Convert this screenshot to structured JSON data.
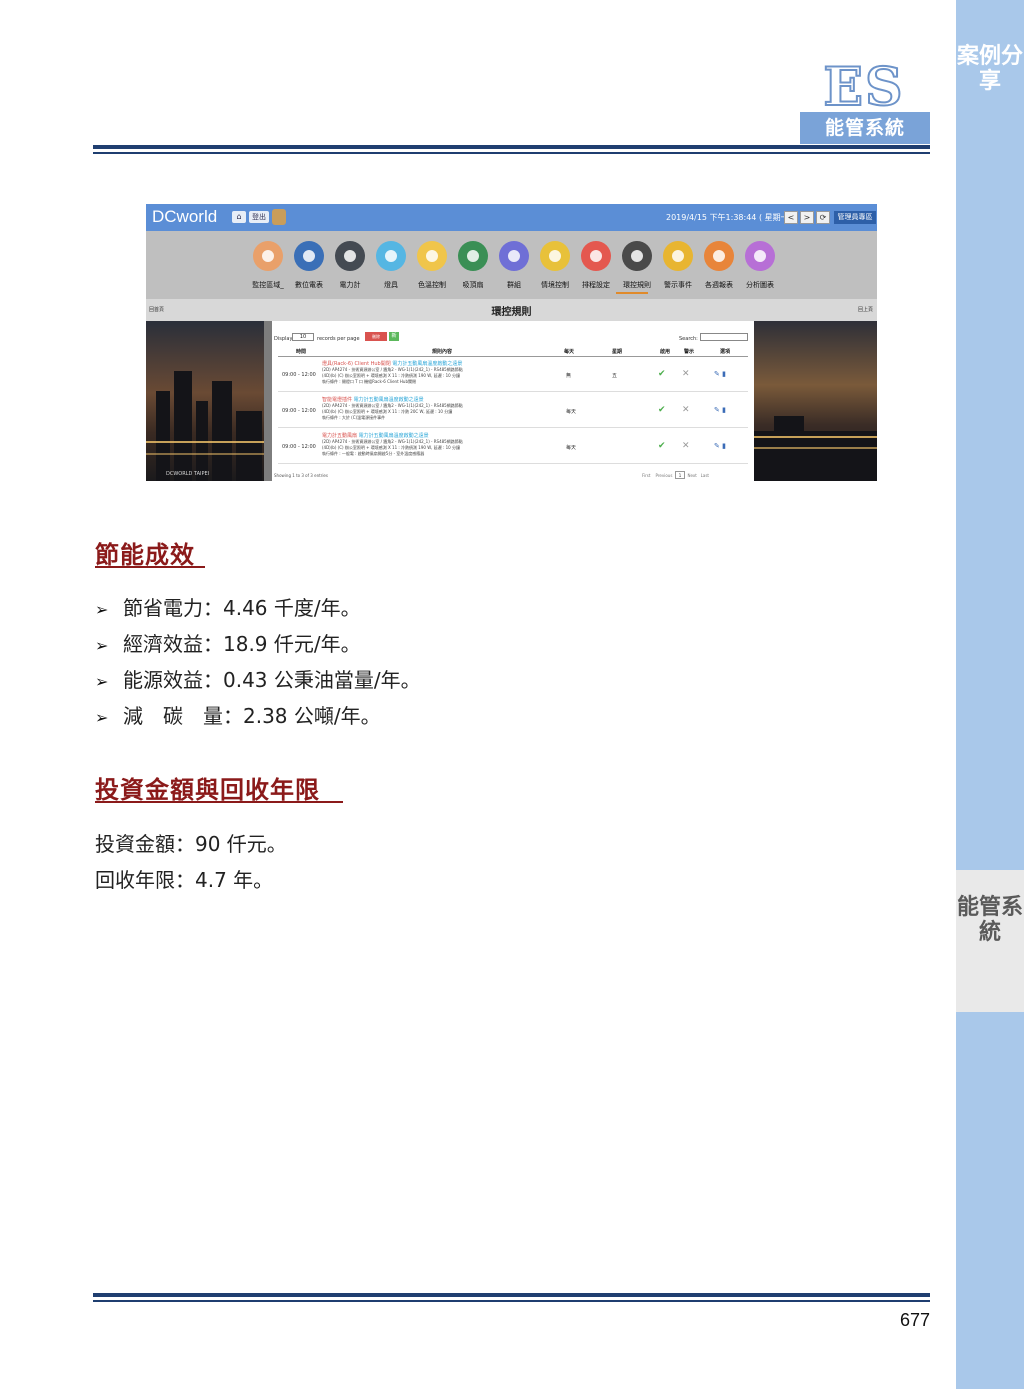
{
  "sidebar": {
    "tab1": "案例分享",
    "tab2": "能管系統"
  },
  "header": {
    "logo_text": "ES",
    "logo_sub": "能管系統"
  },
  "screenshot": {
    "brand": "DCworld",
    "home": "⌂",
    "logout": "登出",
    "datetime": "2019/4/15 下午1:38:44 ( 星期一 )",
    "nav_buttons": [
      "<",
      ">",
      "⟳"
    ],
    "admin": "管理員專區",
    "icons": [
      {
        "label": "監控區域_",
        "icon": "map-pin-icon",
        "color": "#e9a06a"
      },
      {
        "label": "數位電表",
        "icon": "meter-icon",
        "color": "#3a6fb7"
      },
      {
        "label": "電力計",
        "icon": "power-meter-icon",
        "color": "#444a52"
      },
      {
        "label": "燈具",
        "icon": "bulb-icon",
        "color": "#55b6e3"
      },
      {
        "label": "色溫控制",
        "icon": "color-temp-icon",
        "color": "#f0c54a"
      },
      {
        "label": "吸頂扇",
        "icon": "fan-icon",
        "color": "#3a8f55"
      },
      {
        "label": "群組",
        "icon": "group-icon",
        "color": "#6f6fd6"
      },
      {
        "label": "情境控制",
        "icon": "scene-icon",
        "color": "#e8c13a"
      },
      {
        "label": "排程設定",
        "icon": "clock-icon",
        "color": "#e4584f"
      },
      {
        "label": "環控規則",
        "icon": "rule-clock-icon",
        "color": "#4a4a4a"
      },
      {
        "label": "警示事件",
        "icon": "alert-icon",
        "color": "#e8b531"
      },
      {
        "label": "各週報表",
        "icon": "report-icon",
        "color": "#e8853a"
      },
      {
        "label": "分析圖表",
        "icon": "chart-icon",
        "color": "#b76fd6"
      }
    ],
    "page_title": "環控規則",
    "corner_left": "回首頁",
    "corner_right": "回上頁",
    "city_caption": "DCWORLD TAIPEI",
    "table": {
      "show": "Display",
      "per_page_value": "10",
      "per_page_label": "records per page",
      "delete": "刪除",
      "add": "新",
      "search": "Search:",
      "headers": [
        "時間",
        "規則內容",
        "每天",
        "星期",
        "啟用",
        "警示",
        "選項"
      ],
      "rows": [
        {
          "time": "09:00 - 12:00",
          "title_red": "燈具(Rack-6) Client Hub開閉",
          "title_blue": "電力計五動風扇溫度啟動之遠景",
          "lines": [
            "(2D) AP4274 - 技術資源辦公室 / 牆角2 - WG-1(1)(242_1) - RS485網路節點",
            "(4D)(b) (C)   辦公室照明 + 環境感測 X 11 : 冷熱偵測 190 W, 延遲 : 10 分鐘",
            "執行條件 : 開燈口 T 口 機組Rack-6 Client Hub關閉"
          ],
          "day": "無",
          "week": "五",
          "enabled": "✔",
          "alert": "✕"
        },
        {
          "time": "09:00 - 12:00",
          "title_red": "智能電燈插件",
          "title_blue": "電力計五動風扇溫度啟動之遠景",
          "lines": [
            "(2D) AP4274 - 技術資源辦公室 / 牆角2 - WG-1(1)(242_1) - RS485網路節點",
            "(4D)(b) (C)   辦公室照明 + 環境感測 X 11 : 冷熱 20C W, 延遲 : 10 分鐘",
            "執行條件 : 大於 (C)溫電源接件事件"
          ],
          "day": "每天",
          "week": "",
          "enabled": "✔",
          "alert": "✕"
        },
        {
          "time": "09:00 - 12:00",
          "title_red": "電力計五動風扇",
          "title_blue": "電力計五動風扇溫度啟動之遠景",
          "lines": [
            "(2D) AP4274 - 技術資源辦公室 / 牆角2 - WG-1(1)(242_1) - RS485網路節點",
            "(4D)(b) (C)   辦公室照明 + 環境感測 X 11 : 冷熱偵測 190 W, 延遲 : 10 分鐘",
            "執行條件 : 一般電 : 啟動時風扇開啟5分 - 室外溫度感應器"
          ],
          "day": "每天",
          "week": "",
          "enabled": "✔",
          "alert": "✕"
        }
      ],
      "footer": "Showing 1 to 3 of 3 entries",
      "pager_first": "First",
      "pager_prev": "Previous",
      "pager_current": "1",
      "pager_next": "Next",
      "pager_last": "Last"
    }
  },
  "section1": {
    "heading": "節能成效",
    "bullets": [
      "節省電力：4.46 千度/年。",
      "經濟效益：18.9 仟元/年。",
      "能源效益：0.43 公秉油當量/年。",
      "減　碳　量：2.38 公噸/年。"
    ]
  },
  "section2": {
    "heading": "投資金額與回收年限",
    "lines": [
      "投資金額：90 仟元。",
      "回收年限：4.7 年。"
    ]
  },
  "footer": {
    "page_number": "677"
  },
  "colors": {
    "heading": "#8b1a1a",
    "rule": "#1f3e70",
    "sidebar": "#a9c8ea",
    "logo": "#7aa3d8"
  }
}
